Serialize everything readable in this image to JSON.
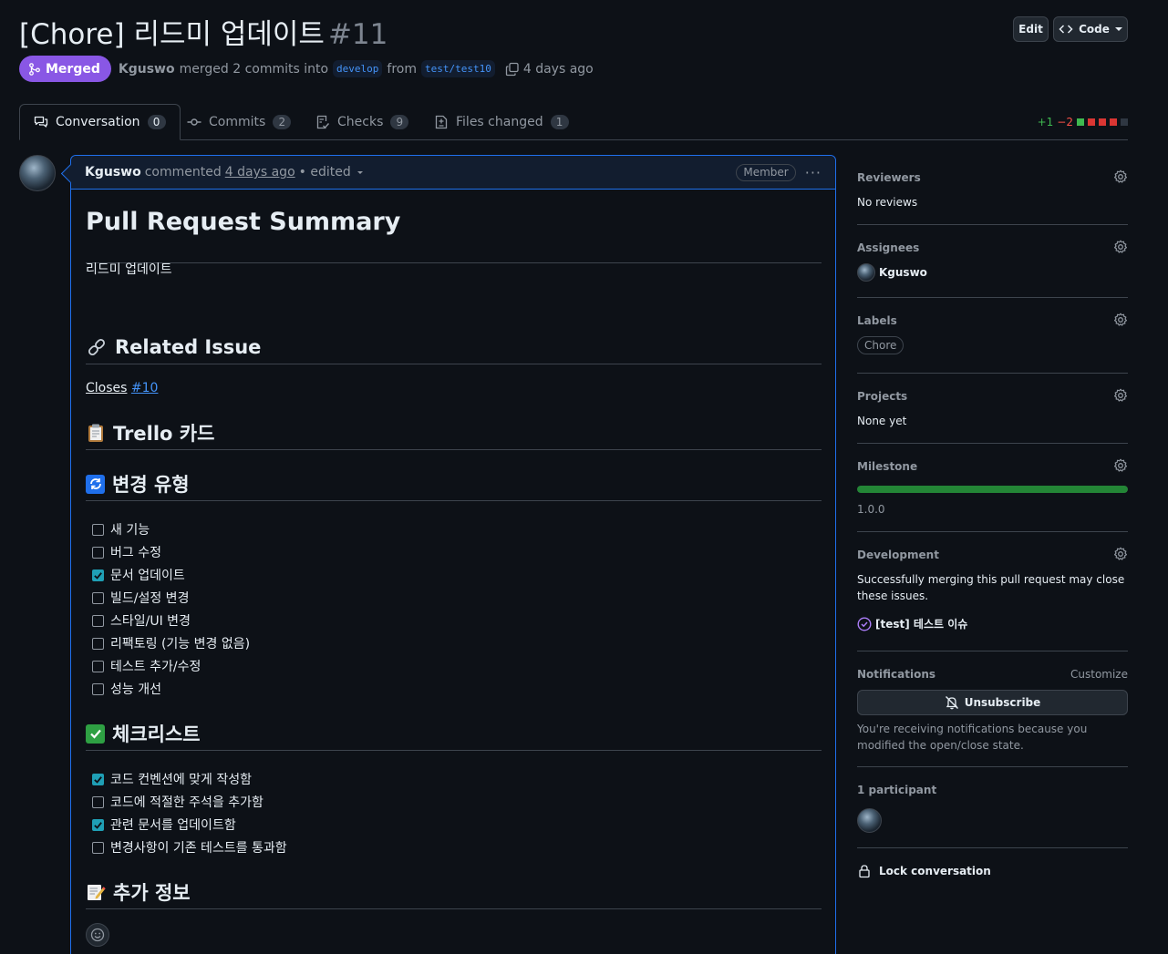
{
  "header": {
    "title": "[Chore] 리드미 업데이트",
    "number": "#11",
    "edit_label": "Edit",
    "code_label": "Code",
    "status": "Merged",
    "author": "Kguswo",
    "merge_text": "merged 2 commits into",
    "base_branch": "develop",
    "from_text": "from",
    "head_branch": "test/test10",
    "time": "4 days ago"
  },
  "tabs": [
    {
      "label": "Conversation",
      "count": "0",
      "icon": "comment-discussion-icon"
    },
    {
      "label": "Commits",
      "count": "2",
      "icon": "commit-icon"
    },
    {
      "label": "Checks",
      "count": "9",
      "icon": "checklist-icon"
    },
    {
      "label": "Files changed",
      "count": "1",
      "icon": "file-diff-icon"
    }
  ],
  "diffstat": {
    "additions": "+1",
    "deletions": "−2",
    "colors": [
      "#3fb950",
      "#da3633",
      "#da3633",
      "#da3633",
      "#2f3742"
    ]
  },
  "comment": {
    "author": "Kguswo",
    "action": "commented",
    "time": "4 days ago",
    "edited": "• edited",
    "role": "Member",
    "menu": "···",
    "h_summary": "Pull Request Summary",
    "summary_text": "리드미 업데이트",
    "h_related": "Related Issue",
    "closes_text": "Closes",
    "closes_link": "#10",
    "h_trello": "Trello 카드",
    "h_change": "변경 유형",
    "change_types": [
      {
        "label": "새 기능",
        "checked": false
      },
      {
        "label": "버그 수정",
        "checked": false
      },
      {
        "label": "문서 업데이트",
        "checked": true
      },
      {
        "label": "빌드/설정 변경",
        "checked": false
      },
      {
        "label": "스타일/UI 변경",
        "checked": false
      },
      {
        "label": "리팩토링 (기능 변경 없음)",
        "checked": false
      },
      {
        "label": "테스트 추가/수정",
        "checked": false
      },
      {
        "label": "성능 개선",
        "checked": false
      }
    ],
    "h_checklist": "체크리스트",
    "checklist": [
      {
        "label": "코드 컨벤션에 맞게 작성함",
        "checked": true
      },
      {
        "label": "코드에 적절한 주석을 추가함",
        "checked": false
      },
      {
        "label": "관련 문서를 업데이트함",
        "checked": true
      },
      {
        "label": "변경사항이 기존 테스트를 통과함",
        "checked": false
      }
    ],
    "h_extra": "추가 정보"
  },
  "sidebar": {
    "reviewers": {
      "title": "Reviewers",
      "value": "No reviews"
    },
    "assignees": {
      "title": "Assignees",
      "value": "Kguswo"
    },
    "labels": {
      "title": "Labels",
      "value": "Chore"
    },
    "projects": {
      "title": "Projects",
      "value": "None yet"
    },
    "milestone": {
      "title": "Milestone",
      "value": "1.0.0",
      "progress": 1.0
    },
    "development": {
      "title": "Development",
      "text": "Successfully merging this pull request may close these issues.",
      "issue": "[test] 테스트 이슈"
    },
    "notifications": {
      "title": "Notifications",
      "customize": "Customize",
      "button": "Unsubscribe",
      "reason": "You're receiving notifications because you modified the open/close state."
    },
    "participants": {
      "title": "1 participant"
    },
    "lock": "Lock conversation"
  }
}
